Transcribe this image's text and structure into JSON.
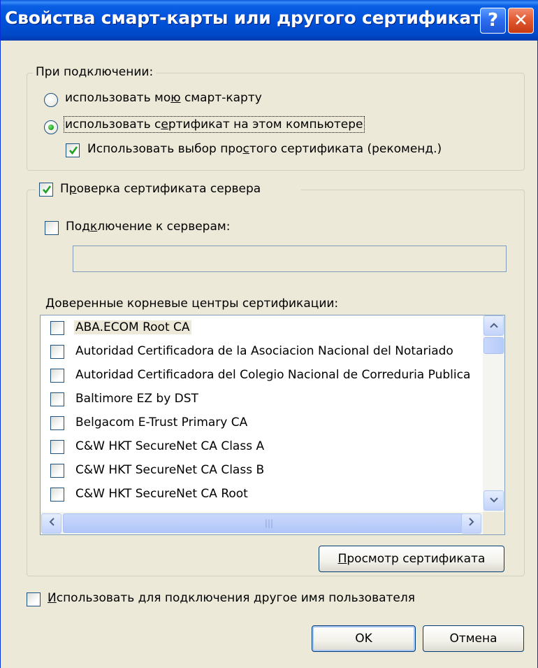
{
  "window": {
    "title": "Свойства смарт-карты или другого сертификата",
    "help_label": "?",
    "close_label": "✕"
  },
  "connect_group": {
    "legend": "При подключении:",
    "radio_smartcard": {
      "pre": "использовать мо",
      "ul": "ю",
      "post": " смарт-карту",
      "checked": false
    },
    "radio_certificate": {
      "pre": "использовать с",
      "ul": "е",
      "post": "ртификат на этом компьютере",
      "checked": true
    },
    "simple_selection": {
      "pre": "Использовать выбор про",
      "ul": "с",
      "post": "того сертификата (рекоменд.)",
      "checked": true
    }
  },
  "server_group": {
    "verify_checkbox": {
      "pre": "П",
      "ul": "р",
      "post": "оверка сертификата сервера",
      "checked": true
    },
    "connect_servers": {
      "pre": "Под",
      "ul": "к",
      "post": "лючение к серверам:",
      "checked": false,
      "value": ""
    },
    "trusted_roots_label": {
      "pre": "",
      "ul": "Д",
      "post": "оверенные корневые центры сертификации:"
    },
    "trusted_roots": [
      {
        "label": "ABA.ECOM Root CA",
        "checked": false,
        "selected": true
      },
      {
        "label": "Autoridad Certificadora de la Asociacion Nacional del Notariado",
        "checked": false
      },
      {
        "label": "Autoridad Certificadora del Colegio Nacional de Correduria Publica",
        "checked": false
      },
      {
        "label": "Baltimore EZ by DST",
        "checked": false
      },
      {
        "label": "Belgacom E-Trust Primary CA",
        "checked": false
      },
      {
        "label": "C&W HKT SecureNet CA Class A",
        "checked": false
      },
      {
        "label": "C&W HKT SecureNet CA Class B",
        "checked": false
      },
      {
        "label": "C&W HKT SecureNet CA Root",
        "checked": false
      }
    ],
    "view_cert_button": {
      "pre": "",
      "ul": "П",
      "post": "росмотр сертификата"
    }
  },
  "other_user": {
    "pre": "",
    "ul": "И",
    "post": "спользовать для подключения другое имя пользователя",
    "checked": false
  },
  "buttons": {
    "ok": "OK",
    "cancel": "Отмена"
  }
}
